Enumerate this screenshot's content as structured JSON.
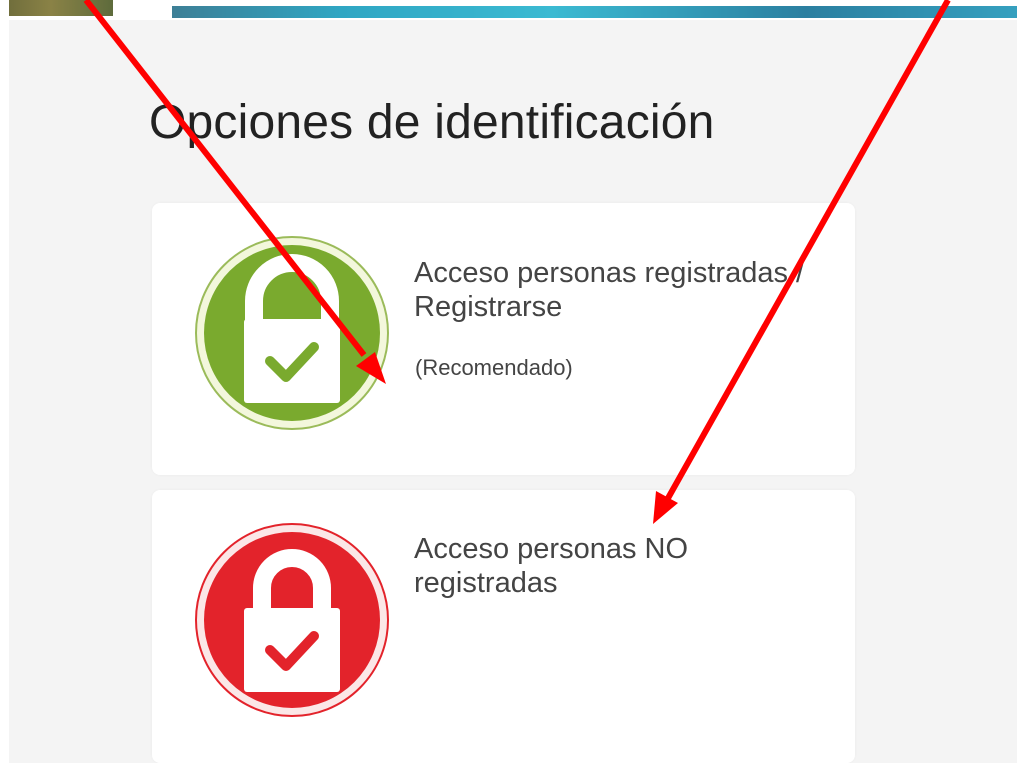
{
  "page": {
    "title": "Opciones de identificación"
  },
  "options": [
    {
      "title": "Acceso personas registradas / Registrarse",
      "note": "(Recomendado)",
      "icon": "lock-green-icon",
      "color": "#7aaa2e"
    },
    {
      "title": "Acceso personas NO registradas",
      "note": "",
      "icon": "lock-red-icon",
      "color": "#e3232b"
    }
  ],
  "annotations": {
    "arrow_color": "#ff0000",
    "arrows": [
      "red-arrow-to-registered-option",
      "red-arrow-to-unregistered-option"
    ]
  }
}
